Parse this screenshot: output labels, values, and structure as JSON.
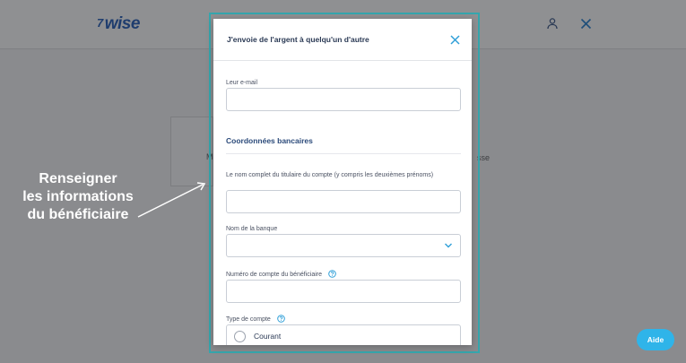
{
  "brand": {
    "name": "wise",
    "mark": "7"
  },
  "background": {
    "fragment_left": "M",
    "fragment_right": "sse"
  },
  "annotation": {
    "line1": "Renseigner",
    "line2": "les informations",
    "line3": "du bénéficiaire"
  },
  "modal": {
    "title": "J'envoie de l'argent à quelqu'un d'autre",
    "email_label": "Leur e-mail",
    "email_value": "",
    "bank_section_title": "Coordonnées bancaires",
    "fullname_label": "Le nom complet du titulaire du compte (y compris les deuxièmes prénoms)",
    "fullname_value": "",
    "bank_name_label": "Nom de la banque",
    "bank_name_value": "",
    "account_number_label": "Numéro de compte du bénéficiaire",
    "account_number_value": "",
    "account_type_label": "Type de compte",
    "account_type_option": "Courant"
  },
  "help_button": {
    "label": "Aide"
  },
  "colors": {
    "accent": "#35a6ad",
    "help_button": "#2fb4e9",
    "link_blue": "#2f9fd8",
    "overlay": "#8a8b8e"
  },
  "icons": {
    "profile": "profile-icon",
    "close_header": "close-icon",
    "close_modal": "close-icon",
    "chevron": "chevron-down-icon",
    "help": "question-circle-icon"
  }
}
